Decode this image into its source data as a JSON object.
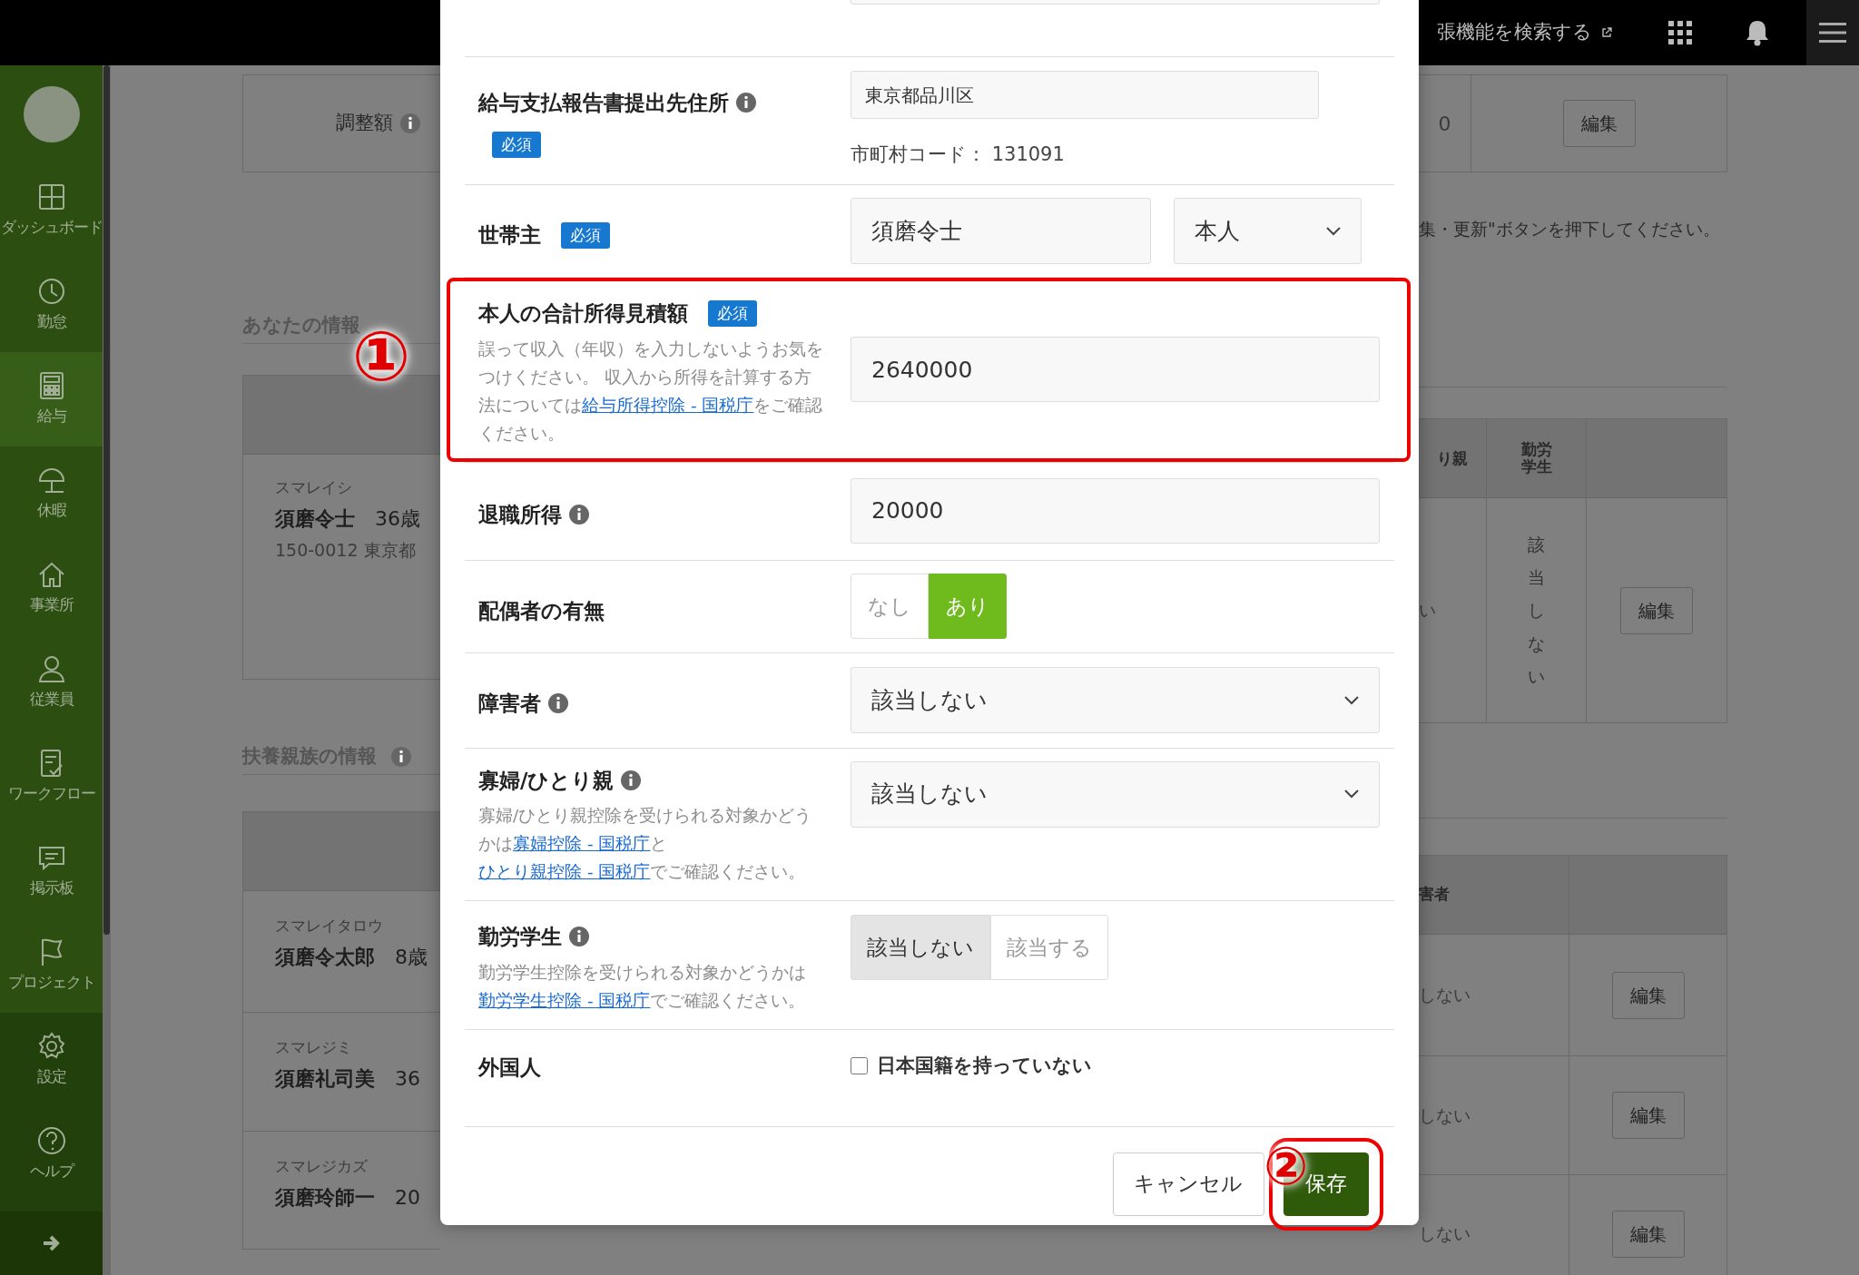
{
  "top_bar": {
    "search_link": "張機能を検索する"
  },
  "sidebar": {
    "items": [
      {
        "label": "ダッシュボード",
        "selected": false
      },
      {
        "label": "勤怠",
        "selected": false
      },
      {
        "label": "給与",
        "selected": true
      },
      {
        "label": "休暇",
        "selected": false
      },
      {
        "label": "事業所",
        "selected": false
      },
      {
        "label": "従業員",
        "selected": false
      },
      {
        "label": "ワークフロー",
        "selected": false
      },
      {
        "label": "掲示板",
        "selected": false
      },
      {
        "label": "プロジェクト",
        "selected": false
      }
    ],
    "footer_items": [
      {
        "label": "設定"
      },
      {
        "label": "ヘルプ"
      }
    ]
  },
  "page": {
    "adjustment": {
      "label": "調整額",
      "value": "0",
      "button": "編集"
    },
    "notice": "集・更新\"ボタンを押下してください。",
    "your_info": {
      "heading": "あなたの情報",
      "columns": [
        "り親",
        "勤労学生"
      ],
      "person": {
        "kana": "スマレイシ",
        "name": "須磨令士",
        "age": "36歳",
        "address": "150-0012 東京都",
        "cell": "い",
        "student": "該当しない",
        "button": "編集"
      }
    },
    "dependents": {
      "heading": "扶養親族の情報",
      "columns": [
        "害者"
      ],
      "rows": [
        {
          "kana": "スマレイタロウ",
          "name": "須磨令太郎",
          "age": "8歳",
          "cell": "しない",
          "button": "編集"
        },
        {
          "kana": "スマレジミ",
          "name": "須磨礼司美",
          "age": "36",
          "cell": "しない",
          "button": "編集"
        },
        {
          "kana": "スマレジカズ",
          "name": "須磨玲師一",
          "age": "20",
          "cell": "しない",
          "button": "編集"
        }
      ]
    }
  },
  "modal": {
    "fields": [
      {
        "kind": "address",
        "label": "給与支払報告書提出先住所",
        "info": true,
        "required": "必須",
        "value": "東京都品川区",
        "note": "市町村コード： 131091"
      },
      {
        "kind": "householder",
        "label": "世帯主",
        "required": "必須",
        "value": "須磨令士",
        "select": "本人"
      },
      {
        "kind": "input",
        "label": "本人の合計所得見積額",
        "required": "必須",
        "highlighted": true,
        "description": [
          {
            "text": "誤って収入（年収）を入力しないようお気をつけください。 収入から所得を計算する方法については"
          },
          {
            "link": "給与所得控除 - 国税庁"
          },
          {
            "text": "をご確認ください。"
          }
        ],
        "value": "2640000"
      },
      {
        "kind": "input",
        "label": "退職所得",
        "info": true,
        "value": "20000"
      },
      {
        "kind": "toggle",
        "label": "配偶者の有無",
        "options": [
          {
            "label": "なし",
            "selected": false
          },
          {
            "label": "あり",
            "selected": true
          }
        ]
      },
      {
        "kind": "select",
        "label": "障害者",
        "info": true,
        "value": "該当しない"
      },
      {
        "kind": "select",
        "label": "寡婦/ひとり親",
        "info": true,
        "description": [
          {
            "text": "寡婦/ひとり親控除を受けられる対象かどうかは"
          },
          {
            "link": "寡婦控除 - 国税庁"
          },
          {
            "text": "と"
          },
          {
            "link": "ひとり親控除 - 国税庁"
          },
          {
            "text": "でご確認ください。"
          }
        ],
        "value": "該当しない"
      },
      {
        "kind": "segment",
        "label": "勤労学生",
        "info": true,
        "description": [
          {
            "text": "勤労学生控除を受けられる対象かどうかは"
          },
          {
            "link": "勤労学生控除 - 国税庁"
          },
          {
            "text": "でご確認ください。"
          }
        ],
        "options": [
          {
            "label": "該当しない",
            "selected": true
          },
          {
            "label": "該当する",
            "selected": false
          }
        ]
      },
      {
        "kind": "checkbox",
        "label": "外国人",
        "option": "日本国籍を持っていない",
        "checked": false
      }
    ],
    "buttons": [
      {
        "label": "キャンセル",
        "kind": "secondary",
        "highlighted": false
      },
      {
        "label": "保存",
        "kind": "primary",
        "highlighted": true
      }
    ]
  },
  "annotations": [
    {
      "label": "①"
    },
    {
      "label": "②"
    }
  ]
}
